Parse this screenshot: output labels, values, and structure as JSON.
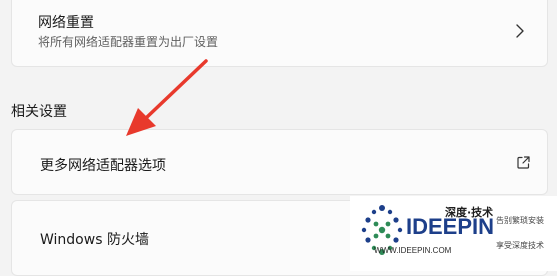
{
  "network_reset": {
    "title": "网络重置",
    "subtitle": "将所有网络适配器重置为出厂设置",
    "chevron_icon": "chevron-right-icon"
  },
  "related_settings": {
    "heading": "相关设置",
    "items": [
      {
        "label": "更多网络适配器选项",
        "icon": "open-external-icon"
      },
      {
        "label": "Windows 防火墙"
      }
    ]
  },
  "annotation": {
    "arrow_color": "#e8392c"
  },
  "watermark": {
    "top_text": "深度·技术",
    "brand": "IDEEPIN",
    "slogan_1": "告别繁琐安装",
    "slogan_2": "享受深度技术",
    "url": "WWW.IDEEPIN.COM"
  }
}
